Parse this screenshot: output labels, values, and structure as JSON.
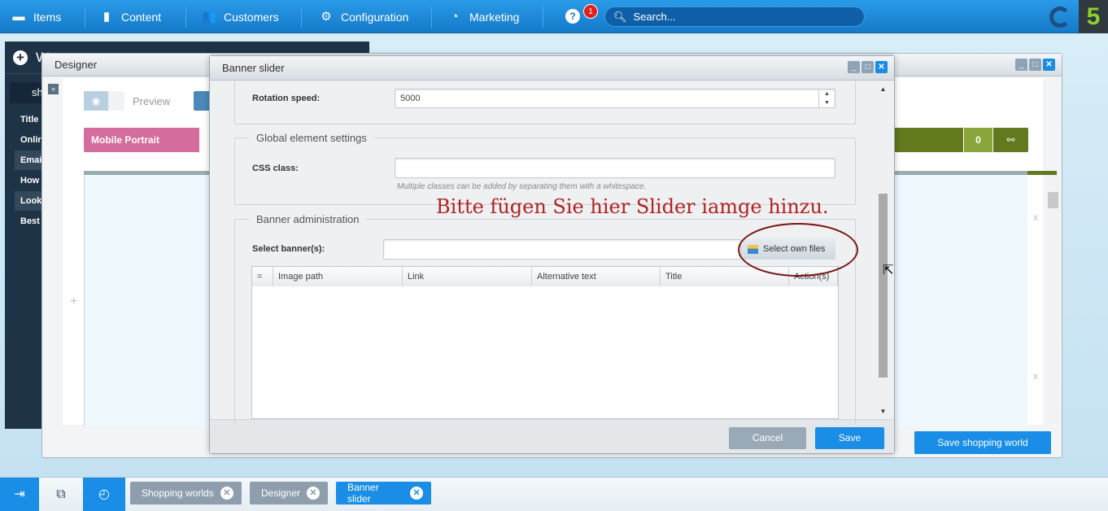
{
  "topbar": {
    "items": [
      {
        "label": "Items",
        "icon": "items-icon"
      },
      {
        "label": "Content",
        "icon": "content-icon"
      },
      {
        "label": "Customers",
        "icon": "customers-icon"
      },
      {
        "label": "Configuration",
        "icon": "gear-icon"
      },
      {
        "label": "Marketing",
        "icon": "pie-chart-icon"
      }
    ],
    "notification_count": "1",
    "search_placeholder": "Search...",
    "logo_text": "5"
  },
  "sidebar_window": {
    "title_partial": "W",
    "tab_partial": "sh",
    "rows": [
      "Title",
      "Onlir",
      "Emai",
      "How",
      "Look",
      "Best"
    ]
  },
  "designer": {
    "title": "Designer",
    "preview_label": "Preview",
    "device_label": "Mobile Portrait",
    "count_badge": "0",
    "save_button": "Save shopping world",
    "delete_marker": "x",
    "add_marker": "+"
  },
  "modal": {
    "title": "Banner slider",
    "rotation_label": "Rotation speed:",
    "rotation_value": "5000",
    "global_legend": "Global element settings",
    "css_label": "CSS class:",
    "css_value": "",
    "css_hint": "Multiple classes can be added by separating them with a whitespace.",
    "banner_legend": "Banner administration",
    "select_label": "Select banner(s):",
    "select_value": "",
    "select_files_button": "Select own files",
    "columns": [
      "=",
      "Image path",
      "Link",
      "Alternative text",
      "Title",
      "Action(s)"
    ],
    "cancel": "Cancel",
    "save": "Save"
  },
  "annotation": {
    "text": "Bitte fügen Sie hier Slider iamge hinzu.",
    "color": "#b22222"
  },
  "taskbar": {
    "tabs": [
      {
        "label": "Shopping worlds",
        "active": false
      },
      {
        "label": "Designer",
        "active": false
      },
      {
        "label": "Banner slider",
        "active": true
      }
    ]
  }
}
